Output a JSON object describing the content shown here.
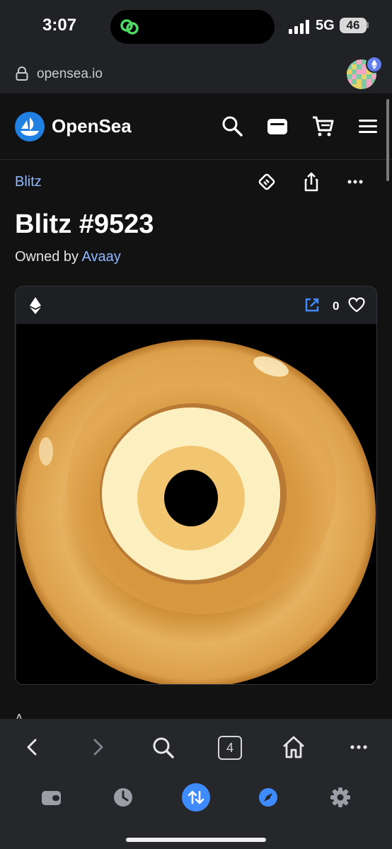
{
  "status_bar": {
    "time": "3:07",
    "network": "5G",
    "battery": "46"
  },
  "browser": {
    "url": "opensea.io"
  },
  "opensea": {
    "brand": "OpenSea",
    "brand_color": "#2081e2"
  },
  "asset": {
    "collection": "Blitz",
    "title": "Blitz #9523",
    "owned_prefix": "Owned by ",
    "owner": "Avaay",
    "favorites": "0",
    "chain_icon": "ethereum-icon",
    "next_section_peek": "A"
  },
  "toolbar": {
    "tabs_count": "4"
  },
  "colors": {
    "link": "#8fb8ff",
    "accent_blue": "#3d8bfd",
    "background": "#121212"
  }
}
